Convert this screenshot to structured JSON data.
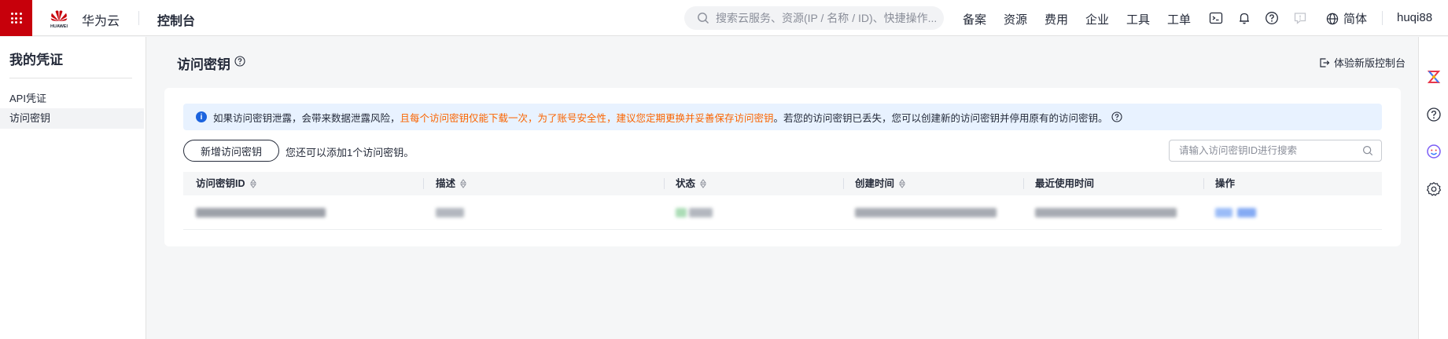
{
  "topbar": {
    "brand_name": "华为云",
    "logo_text": "HUAWEI",
    "console_label": "控制台",
    "search_placeholder": "搜索云服务、资源(IP / 名称 / ID)、快捷操作...",
    "nav": [
      "备案",
      "资源",
      "费用",
      "企业",
      "工具",
      "工单"
    ],
    "language": "简体",
    "username": "huqi88"
  },
  "sidebar": {
    "title": "我的凭证",
    "items": [
      {
        "label": "API凭证",
        "active": false
      },
      {
        "label": "访问密钥",
        "active": true
      }
    ]
  },
  "main": {
    "title": "访问密钥",
    "new_console_link": "体验新版控制台",
    "alert": {
      "part1": "如果访问密钥泄露，会带来数据泄露风险，",
      "warning": "且每个访问密钥仅能下载一次，为了账号安全性，建议您定期更换并妥善保存访问密钥",
      "part2": "。若您的访问密钥已丢失，您可以创建新的访问密钥并停用原有的访问密钥。"
    },
    "add_button": "新增访问密钥",
    "add_tip": "您还可以添加1个访问密钥。",
    "search_placeholder": "请输入访问密钥ID进行搜索",
    "table": {
      "columns": [
        "访问密钥ID",
        "描述",
        "状态",
        "创建时间",
        "最近使用时间",
        "操作"
      ],
      "rows_redacted": 1
    }
  },
  "colors": {
    "brand_red": "#c7000b",
    "warning_orange": "#fa6400",
    "info_blue": "#1b63de",
    "alert_bg": "#e8f2ff"
  }
}
